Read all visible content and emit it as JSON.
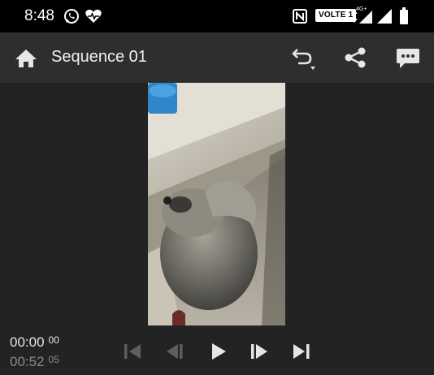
{
  "status_bar": {
    "time": "8:48",
    "volte_label": "VOLTE 1",
    "network_label": "4G+",
    "icons": [
      "whatsapp-icon",
      "heart-app-icon",
      "nfc-icon",
      "volte-icon",
      "data-arrows-icon",
      "signal-icon",
      "battery-icon"
    ]
  },
  "app_bar": {
    "title": "Sequence 01",
    "icons": [
      "home-icon",
      "undo-icon",
      "share-icon",
      "feedback-icon"
    ]
  },
  "playback": {
    "current_time": "00:00",
    "current_frames": "00",
    "total_time": "00:52",
    "total_frames": "05",
    "icons": [
      "skip-to-start-icon",
      "step-back-icon",
      "play-icon",
      "step-forward-icon",
      "skip-to-end-icon"
    ]
  },
  "colors": {
    "background": "#232323",
    "app_bar": "#2e2e2e",
    "status_bar": "#000000",
    "control_enabled": "#e6e6e6",
    "control_disabled": "#5e5e5e"
  }
}
